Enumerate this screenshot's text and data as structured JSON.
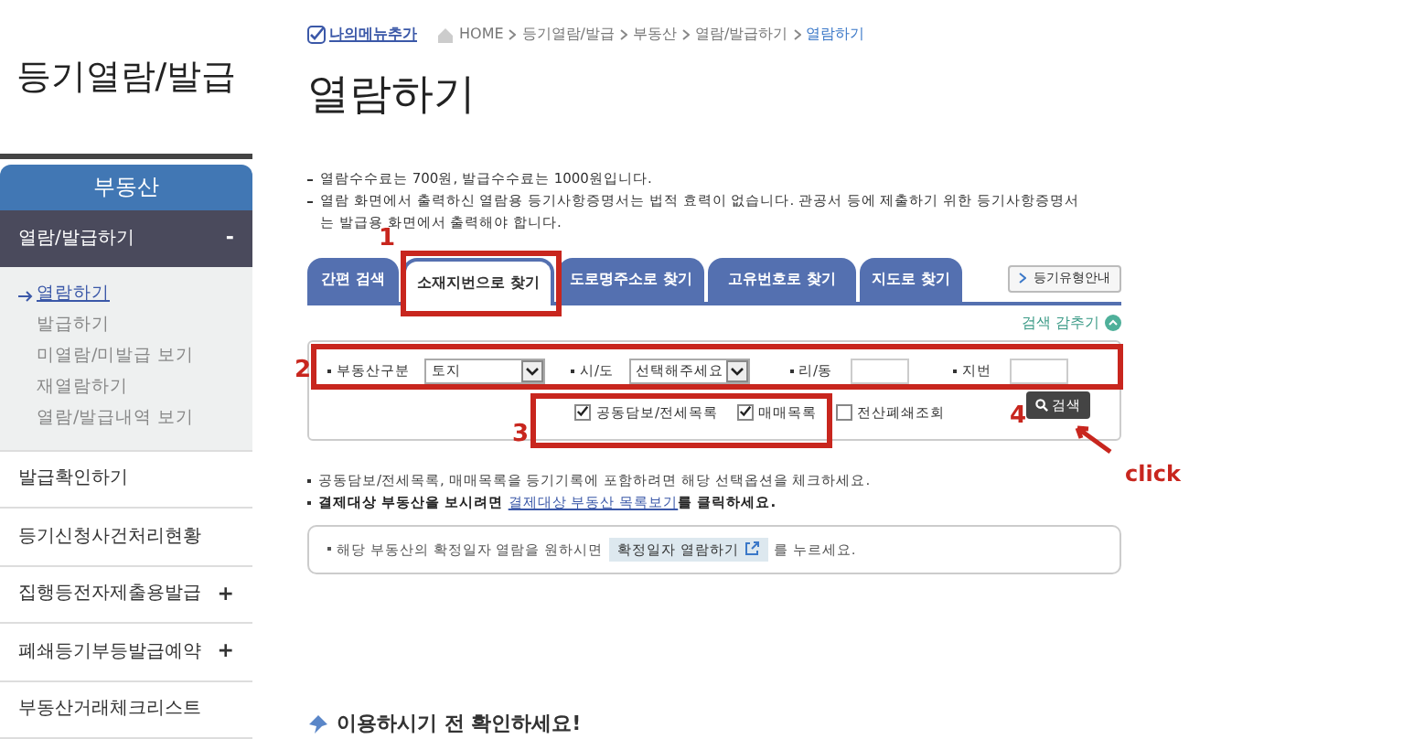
{
  "sidebar": {
    "title": "등기열람/발급",
    "section_header": "부동산",
    "menu": [
      {
        "label": "열람/발급하기",
        "toggle": "-",
        "expanded": true,
        "children": [
          {
            "label": "열람하기",
            "selected": true
          },
          {
            "label": "발급하기",
            "selected": false
          },
          {
            "label": "미열람/미발급 보기",
            "selected": false
          },
          {
            "label": "재열람하기",
            "selected": false
          },
          {
            "label": "열람/발급내역 보기",
            "selected": false
          }
        ]
      },
      {
        "label": "발급확인하기"
      },
      {
        "label": "등기신청사건처리현황"
      },
      {
        "label": "집행등전자제출용발급",
        "toggle": "+",
        "expanded": false
      },
      {
        "label": "폐쇄등기부등발급예약",
        "toggle": "+",
        "expanded": false
      },
      {
        "label": "부동산거래체크리스트"
      }
    ]
  },
  "breadcrumb": {
    "my_menu": "나의메뉴추가",
    "items": [
      "HOME",
      "등기열람/발급",
      "부동산",
      "열람/발급하기",
      "열람하기"
    ]
  },
  "page_title": "열람하기",
  "notes": [
    "열람수수료는 700원, 발급수수료는 1000원입니다.",
    "열람 화면에서 출력하신 열람용 등기사항증명서는 법적 효력이 없습니다. 관공서 등에 제출하기 위한 등기사항증명서는 발급용 화면에서 출력해야 합니다."
  ],
  "tabs": [
    {
      "label": "간편 검색",
      "selected": false
    },
    {
      "label": "소재지번으로 찾기",
      "selected": true
    },
    {
      "label": "도로명주소로 찾기",
      "selected": false
    },
    {
      "label": "고유번호로 찾기",
      "selected": false
    },
    {
      "label": "지도로 찾기",
      "selected": false
    }
  ],
  "guide_button": "등기유형안내",
  "hide_search": "검색 감추기",
  "form": {
    "fields": [
      {
        "kind": "select",
        "label": "부동산구분",
        "value": "토지"
      },
      {
        "kind": "select",
        "label": "시/도",
        "value": "선택해주세요"
      },
      {
        "kind": "input",
        "label": "리/동"
      },
      {
        "kind": "input",
        "label": "지번"
      }
    ],
    "options": [
      {
        "label": "공동담보/전세목록",
        "checked": true
      },
      {
        "label": "매매목록",
        "checked": true
      },
      {
        "label": "전산폐쇄조회",
        "checked": false
      }
    ],
    "search_button": "검색"
  },
  "hints": [
    {
      "text": "공동담보/전세목록, 매매목록을 등기기록에 포함하려면 해당 선택옵션을 체크하세요."
    },
    {
      "text": "결제대상 부동산을 보시려면 ",
      "link": "결제대상 부동산 목록보기",
      "after": "를 클릭하세요."
    }
  ],
  "notice": {
    "before": "해당 부동산의 확정일자 열람을 원하시면",
    "button": "확정일자 열람하기",
    "after": "를 누르세요."
  },
  "bottom_heading": "이용하시기 전 확인하세요!",
  "annotations": [
    {
      "kind": "box",
      "label": "1"
    },
    {
      "kind": "box",
      "label": "2"
    },
    {
      "kind": "box",
      "label": "3"
    },
    {
      "kind": "arrow",
      "label": "4",
      "note": "click"
    }
  ]
}
